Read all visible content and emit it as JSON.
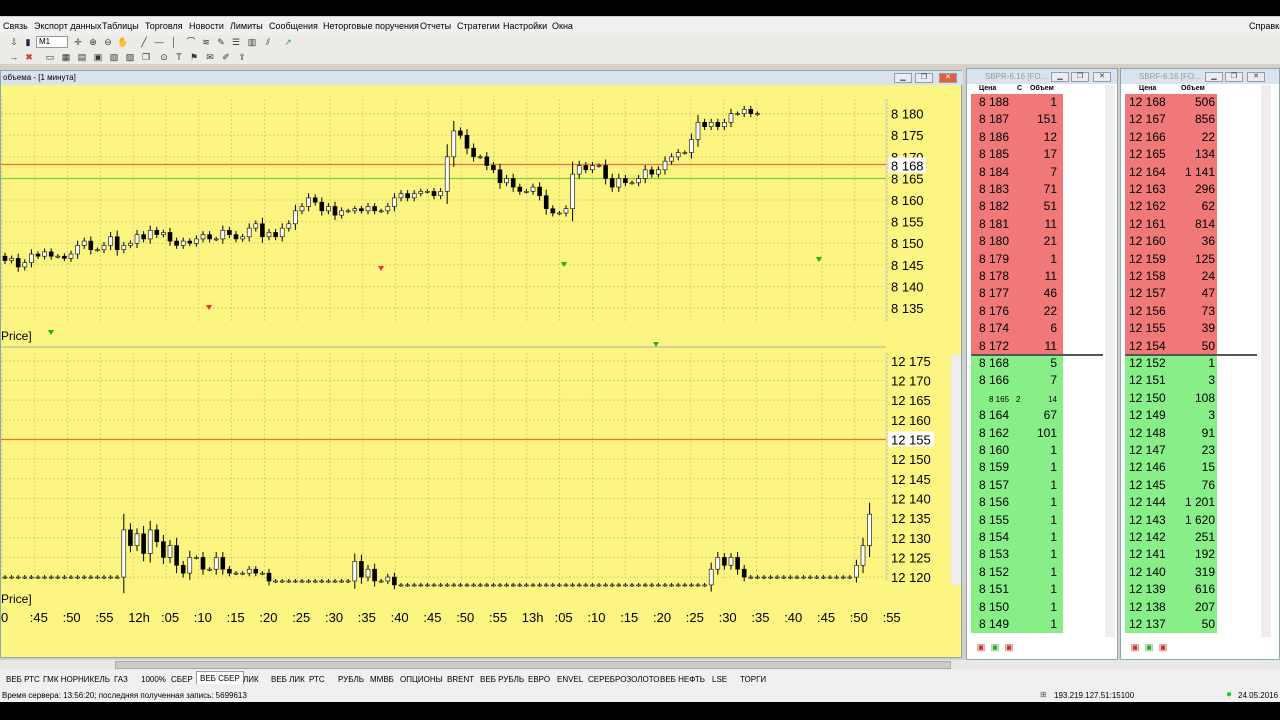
{
  "menu": [
    "Связь",
    "Экспорт данных",
    "Таблицы",
    "Торговля",
    "Новости",
    "Лимиты",
    "Сообщения",
    "Неторговые поручения",
    "Отчеты",
    "Стратегии",
    "Настройки",
    "Окна"
  ],
  "menu_help": "Справка",
  "toolbar": {
    "interval": "M1"
  },
  "chart_window": {
    "title": "объема - [1 минута]",
    "price_label_1": "Price]",
    "price_label_2": "Price]",
    "upper": {
      "ticks": [
        "8 180",
        "8 175",
        "8 170",
        "8 165",
        "8 160",
        "8 155",
        "8 150",
        "8 145",
        "8 140",
        "8 135"
      ],
      "current": "8 168",
      "ylim": [
        8132,
        8182
      ]
    },
    "lower": {
      "ticks": [
        "12 175",
        "12 170",
        "12 165",
        "12 160",
        "12 155",
        "12 150",
        "12 145",
        "12 140",
        "12 135",
        "12 130",
        "12 125",
        "12 120"
      ],
      "current": "12 155",
      "ylim": [
        12119,
        12177
      ]
    },
    "time_labels": [
      "0",
      ":45",
      ":50",
      ":55",
      "12h",
      ":05",
      ":10",
      ":15",
      ":20",
      ":25",
      ":30",
      ":35",
      ":40",
      ":45",
      ":50",
      ":55",
      "13h",
      ":05",
      ":10",
      ":15",
      ":20",
      ":25",
      ":30",
      ":35",
      ":40",
      ":45",
      ":50",
      ":55"
    ]
  },
  "orderbook_1": {
    "title": "SBPR-6.16 [FO...",
    "col_price": "Цена",
    "col_c": "С",
    "col_volume": "Объем",
    "asks": [
      [
        "8 188",
        "1"
      ],
      [
        "8 187",
        "151"
      ],
      [
        "8 186",
        "12"
      ],
      [
        "8 185",
        "17"
      ],
      [
        "8 184",
        "7"
      ],
      [
        "8 183",
        "71"
      ],
      [
        "8 182",
        "51"
      ],
      [
        "8 181",
        "11"
      ],
      [
        "8 180",
        "21"
      ],
      [
        "8 179",
        "1"
      ],
      [
        "8 178",
        "11"
      ],
      [
        "8 177",
        "46"
      ],
      [
        "8 176",
        "22"
      ],
      [
        "8 174",
        "6"
      ],
      [
        "8 172",
        "11"
      ]
    ],
    "bids": [
      [
        "8 168",
        "5"
      ],
      [
        "8 166",
        "7"
      ],
      [
        "8 165",
        "14",
        "2"
      ],
      [
        "8 164",
        "67"
      ],
      [
        "8 162",
        "101"
      ],
      [
        "8 160",
        "1"
      ],
      [
        "8 159",
        "1"
      ],
      [
        "8 157",
        "1"
      ],
      [
        "8 156",
        "1"
      ],
      [
        "8 155",
        "1"
      ],
      [
        "8 154",
        "1"
      ],
      [
        "8 153",
        "1"
      ],
      [
        "8 152",
        "1"
      ],
      [
        "8 151",
        "1"
      ],
      [
        "8 150",
        "1"
      ],
      [
        "8 149",
        "1"
      ]
    ]
  },
  "orderbook_2": {
    "title": "SBRF-6.16 [FO...",
    "col_price": "Цена",
    "col_volume": "Объем",
    "asks": [
      [
        "12 168",
        "506"
      ],
      [
        "12 167",
        "856"
      ],
      [
        "12 166",
        "22"
      ],
      [
        "12 165",
        "134"
      ],
      [
        "12 164",
        "1 141"
      ],
      [
        "12 163",
        "296"
      ],
      [
        "12 162",
        "62"
      ],
      [
        "12 161",
        "814"
      ],
      [
        "12 160",
        "36"
      ],
      [
        "12 159",
        "125"
      ],
      [
        "12 158",
        "24"
      ],
      [
        "12 157",
        "47"
      ],
      [
        "12 156",
        "73"
      ],
      [
        "12 155",
        "39"
      ],
      [
        "12 154",
        "50"
      ]
    ],
    "bids": [
      [
        "12 152",
        "1"
      ],
      [
        "12 151",
        "3"
      ],
      [
        "12 150",
        "108"
      ],
      [
        "12 149",
        "3"
      ],
      [
        "12 148",
        "91"
      ],
      [
        "12 147",
        "23"
      ],
      [
        "12 146",
        "15"
      ],
      [
        "12 145",
        "76"
      ],
      [
        "12 144",
        "1 201"
      ],
      [
        "12 143",
        "1 620"
      ],
      [
        "12 142",
        "251"
      ],
      [
        "12 141",
        "192"
      ],
      [
        "12 140",
        "319"
      ],
      [
        "12 139",
        "616"
      ],
      [
        "12 138",
        "207"
      ],
      [
        "12 137",
        "50"
      ]
    ]
  },
  "tabs": [
    "ВЕБ РТС",
    "ГМК НОРНИКЕЛЬ",
    "ГАЗ",
    "1000%",
    "СБЕР",
    "ВЕБ СБЕР",
    "ЛИК",
    "ВЕБ ЛИК",
    "РТС",
    "РУБЛЬ",
    "ММВБ",
    "ОПЦИОНЫ",
    "BRENT",
    "ВЕБ РУБЛЬ",
    "ЕВРО",
    "ENVEL",
    "СЕРЕБРОЗОЛОТО",
    "ВЕБ НЕФТЬ",
    "LSE",
    "ТОРГИ"
  ],
  "active_tab": "ВЕБ СБЕР",
  "status": {
    "left": "Время сервера: 13:56:20; последняя полученная запись: 5699613",
    "ip": "193.219.127.51:15100",
    "date": "24.05.2016"
  },
  "colors": {
    "chart_bg": "#fdf581",
    "ask": "#f07878",
    "bid": "#88ee88",
    "grid": "#d8d070"
  }
}
